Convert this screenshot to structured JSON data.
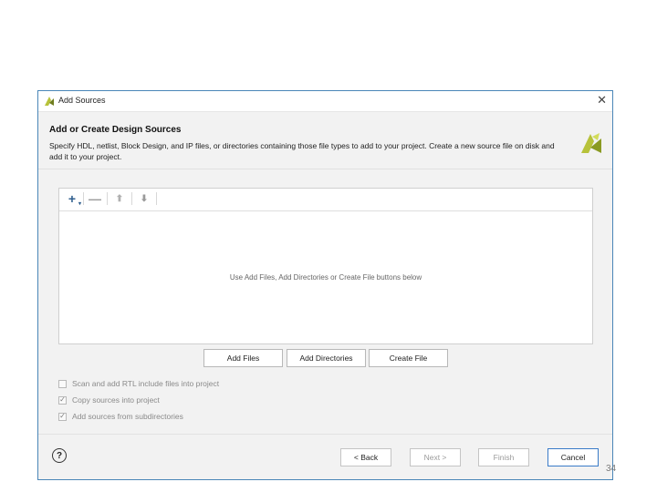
{
  "window": {
    "title": "Add Sources",
    "close_glyph": "✕"
  },
  "header": {
    "title": "Add or Create Design Sources",
    "description": "Specify HDL, netlist, Block Design, and IP files, or directories containing those file types to add to your project. Create a new source file on disk and add it to your project."
  },
  "toolbar": {
    "add_glyph": "+",
    "add_dropdown_glyph": "▾",
    "remove_glyph": "—",
    "up_glyph": "⬆",
    "down_glyph": "⬇"
  },
  "files_panel": {
    "hint": "Use Add Files, Add Directories or Create File buttons below"
  },
  "buttons": {
    "add_files": "Add Files",
    "add_directories": "Add Directories",
    "create_file": "Create File"
  },
  "options": [
    {
      "label": "Scan and add RTL include files into project",
      "checked": false
    },
    {
      "label": "Copy sources into project",
      "checked": true
    },
    {
      "label": "Add sources from subdirectories",
      "checked": true
    }
  ],
  "footer": {
    "help_glyph": "?",
    "back": "< Back",
    "next": "Next >",
    "finish": "Finish",
    "cancel": "Cancel"
  },
  "page_number": "34",
  "colors": {
    "dialog_border": "#4a86b8",
    "logo_green": "#b7c23a",
    "accent": "#3a7bc8"
  }
}
